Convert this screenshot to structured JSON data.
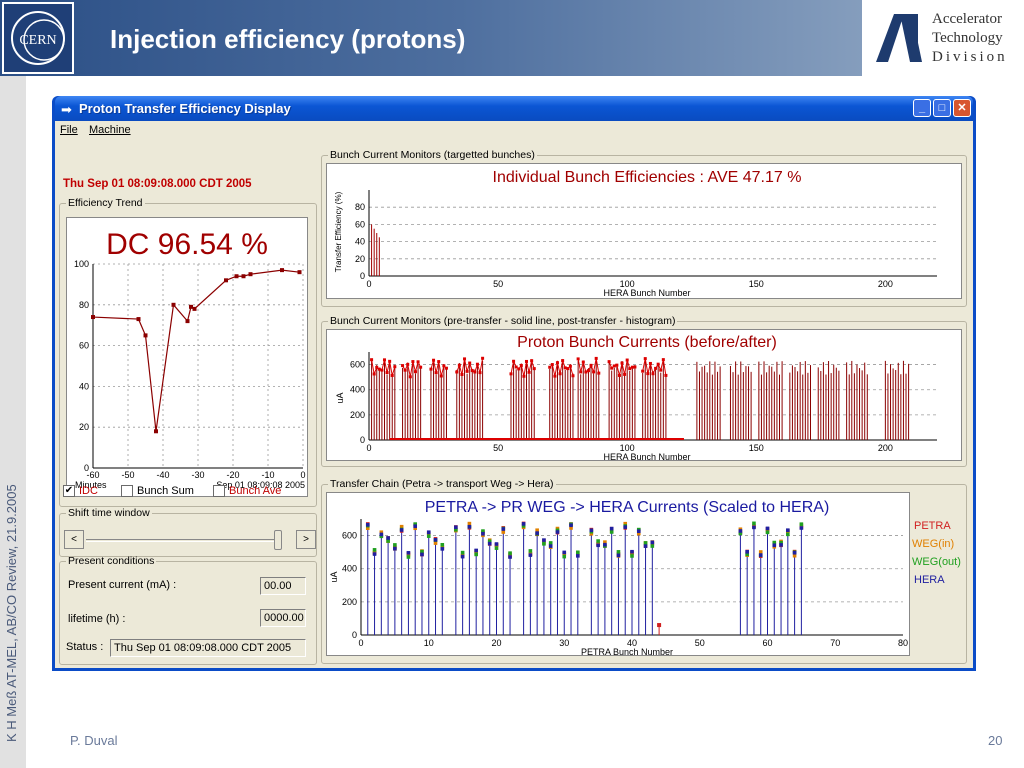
{
  "slide": {
    "title": "Injection efficiency (protons)",
    "cern_logo_text": "CERN",
    "division": {
      "line1": "Accelerator",
      "line2": "Technology",
      "line3": "Division"
    },
    "sidebar_text": "K H Meß AT-MEL, AB/CO Review, 21.9.2005",
    "author": "P. Duval",
    "page_number": "20"
  },
  "window": {
    "title": "Proton Transfer Efficiency Display",
    "menu": {
      "file": "File",
      "machine": "Machine"
    },
    "timestamp": "Thu Sep 01 08:09:08.000 CDT 2005",
    "efficiency_trend": {
      "legend": "Efficiency Trend",
      "headline": "DC  96.54 %",
      "xlabel": "Minutes",
      "xlabel_right": "Sep 01 08:09:08 2005"
    },
    "checkboxes": {
      "idc": {
        "label": "IDC",
        "checked": true
      },
      "bunch_sum": {
        "label": "Bunch Sum",
        "checked": false
      },
      "bunch_ave": {
        "label": "Bunch Ave",
        "checked": false
      }
    },
    "shift_window": {
      "legend": "Shift time window",
      "left_arrow": "<",
      "right_arrow": ">"
    },
    "present": {
      "legend": "Present conditions",
      "current_label": "Present current (mA) :",
      "current_value": "00.00",
      "lifetime_label": "lifetime (h) :",
      "lifetime_value": "0000.00",
      "status_label": "Status :",
      "status_value": "Thu Sep 01 08:09:08.000 CDT 2005"
    },
    "groups": {
      "bcm_targeted": "Bunch Current Monitors (targetted bunches)",
      "bcm_pre_post": "Bunch Current Monitors (pre-transfer - solid line, post-transfer - histogram)",
      "transfer_chain": "Transfer Chain (Petra -> transport Weg -> Hera)"
    },
    "colors": {
      "accent_red": "#c00000",
      "hera_blue": "#2020a0",
      "petra_red": "#d02020",
      "weg_in_orange": "#e08000",
      "weg_out_green": "#20a020"
    }
  },
  "chart_data": [
    {
      "type": "line",
      "title": "",
      "xlabel": "Minutes",
      "ylabel": "",
      "xlim": [
        -60,
        0
      ],
      "ylim": [
        0,
        100
      ],
      "x_ticks": [
        -60,
        -50,
        -40,
        -30,
        -20,
        -10,
        0
      ],
      "y_ticks": [
        0,
        20,
        40,
        60,
        80,
        100
      ],
      "x": [
        -60,
        -47,
        -45,
        -42,
        -37,
        -33,
        -32,
        -31,
        -22,
        -19,
        -17,
        -15,
        -6,
        -1
      ],
      "y": [
        74,
        73,
        65,
        18,
        80,
        72,
        79,
        78,
        92,
        94,
        94,
        95,
        97,
        96
      ],
      "grid": true
    },
    {
      "type": "bar",
      "title": "Individual Bunch Efficiencies : AVE 47.17 %",
      "xlabel": "HERA Bunch Number",
      "ylabel": "Transfer Efficiency (%)",
      "xlim": [
        0,
        220
      ],
      "ylim": [
        0,
        100
      ],
      "x_ticks": [
        0,
        50,
        100,
        150,
        200
      ],
      "y_ticks": [
        0,
        20,
        40,
        60,
        80
      ],
      "x": [
        1,
        2,
        3,
        4
      ],
      "values": [
        60,
        55,
        50,
        45
      ],
      "grid": true
    },
    {
      "type": "bar",
      "title": "Proton Bunch Currents (before/after)",
      "xlabel": "HERA Bunch Number",
      "ylabel": "uA",
      "xlim": [
        0,
        220
      ],
      "ylim": [
        0,
        700
      ],
      "x_ticks": [
        0,
        50,
        100,
        150,
        200
      ],
      "y_ticks": [
        0,
        200,
        400,
        600
      ],
      "groups": [
        [
          1,
          10
        ],
        [
          13,
          20
        ],
        [
          24,
          30
        ],
        [
          34,
          44
        ],
        [
          55,
          64
        ],
        [
          70,
          79
        ],
        [
          81,
          89
        ],
        [
          93,
          103
        ],
        [
          106,
          115
        ],
        [
          127,
          136
        ],
        [
          140,
          148
        ],
        [
          151,
          160
        ],
        [
          163,
          171
        ],
        [
          174,
          182
        ],
        [
          185,
          193
        ],
        [
          200,
          209
        ]
      ],
      "value_range": [
        520,
        630
      ],
      "grid": true
    },
    {
      "type": "scatter",
      "title": "PETRA -> PR WEG -> HERA Currents (Scaled to HERA)",
      "xlabel": "PETRA Bunch Number",
      "ylabel": "uA",
      "xlim": [
        0,
        80
      ],
      "ylim": [
        0,
        700
      ],
      "x_ticks": [
        0,
        10,
        20,
        30,
        40,
        50,
        60,
        70,
        80
      ],
      "y_ticks": [
        0,
        200,
        400,
        600
      ],
      "groups": [
        [
          1,
          12
        ],
        [
          14,
          22
        ],
        [
          24,
          32
        ],
        [
          34,
          43
        ],
        [
          56,
          65
        ]
      ],
      "value_range": [
        480,
        660
      ],
      "series": [
        {
          "name": "PETRA"
        },
        {
          "name": "WEG(in)"
        },
        {
          "name": "WEG(out)"
        },
        {
          "name": "HERA"
        }
      ],
      "grid": true
    }
  ]
}
